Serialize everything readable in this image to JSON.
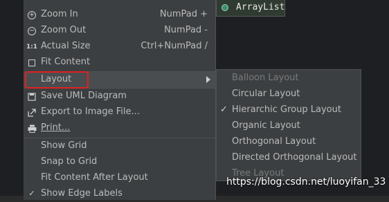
{
  "diagram": {
    "class_name": "ArrayList"
  },
  "menu": {
    "items": [
      {
        "label": "Zoom In",
        "shortcut": "NumPad +",
        "icon": "zoom-in-icon"
      },
      {
        "label": "Zoom Out",
        "shortcut": "NumPad -",
        "icon": "zoom-out-icon"
      },
      {
        "label": "Actual Size",
        "shortcut": "Ctrl+NumPad /",
        "icon": "actual-size-icon",
        "icon_text": "1:1"
      },
      {
        "label": "Fit Content",
        "shortcut": "",
        "icon": "fit-content-icon"
      },
      {
        "label": "Layout",
        "shortcut": "",
        "icon": "",
        "submenu": true
      },
      {
        "label": "Save UML Diagram",
        "shortcut": "",
        "icon": "save-icon"
      },
      {
        "label": "Export to Image File...",
        "shortcut": "",
        "icon": "export-icon"
      },
      {
        "label": "Print...",
        "shortcut": "",
        "icon": "print-icon"
      },
      {
        "label": "Show Grid",
        "shortcut": "",
        "icon": ""
      },
      {
        "label": "Snap to Grid",
        "shortcut": "",
        "icon": ""
      },
      {
        "label": "Fit Content After Layout",
        "shortcut": "",
        "icon": ""
      },
      {
        "label": "Show Edge Labels",
        "shortcut": "",
        "icon": "check-icon"
      }
    ]
  },
  "layout_submenu": {
    "items": [
      {
        "label": "Balloon Layout",
        "disabled": true,
        "checked": false
      },
      {
        "label": "Circular Layout",
        "disabled": false,
        "checked": false
      },
      {
        "label": "Hierarchic Group Layout",
        "disabled": false,
        "checked": true
      },
      {
        "label": "Organic Layout",
        "disabled": false,
        "checked": false
      },
      {
        "label": "Orthogonal Layout",
        "disabled": false,
        "checked": false
      },
      {
        "label": "Directed Orthogonal Layout",
        "disabled": false,
        "checked": false
      },
      {
        "label": "Tree Layout",
        "disabled": true,
        "checked": false
      }
    ]
  },
  "watermark": "https://blog.csdn.net/luoyifan_33",
  "colors": {
    "menu_bg": "#3c3f41",
    "highlight_box": "#e02020",
    "text": "#bbbbbb",
    "disabled_text": "#7a7a7a"
  }
}
